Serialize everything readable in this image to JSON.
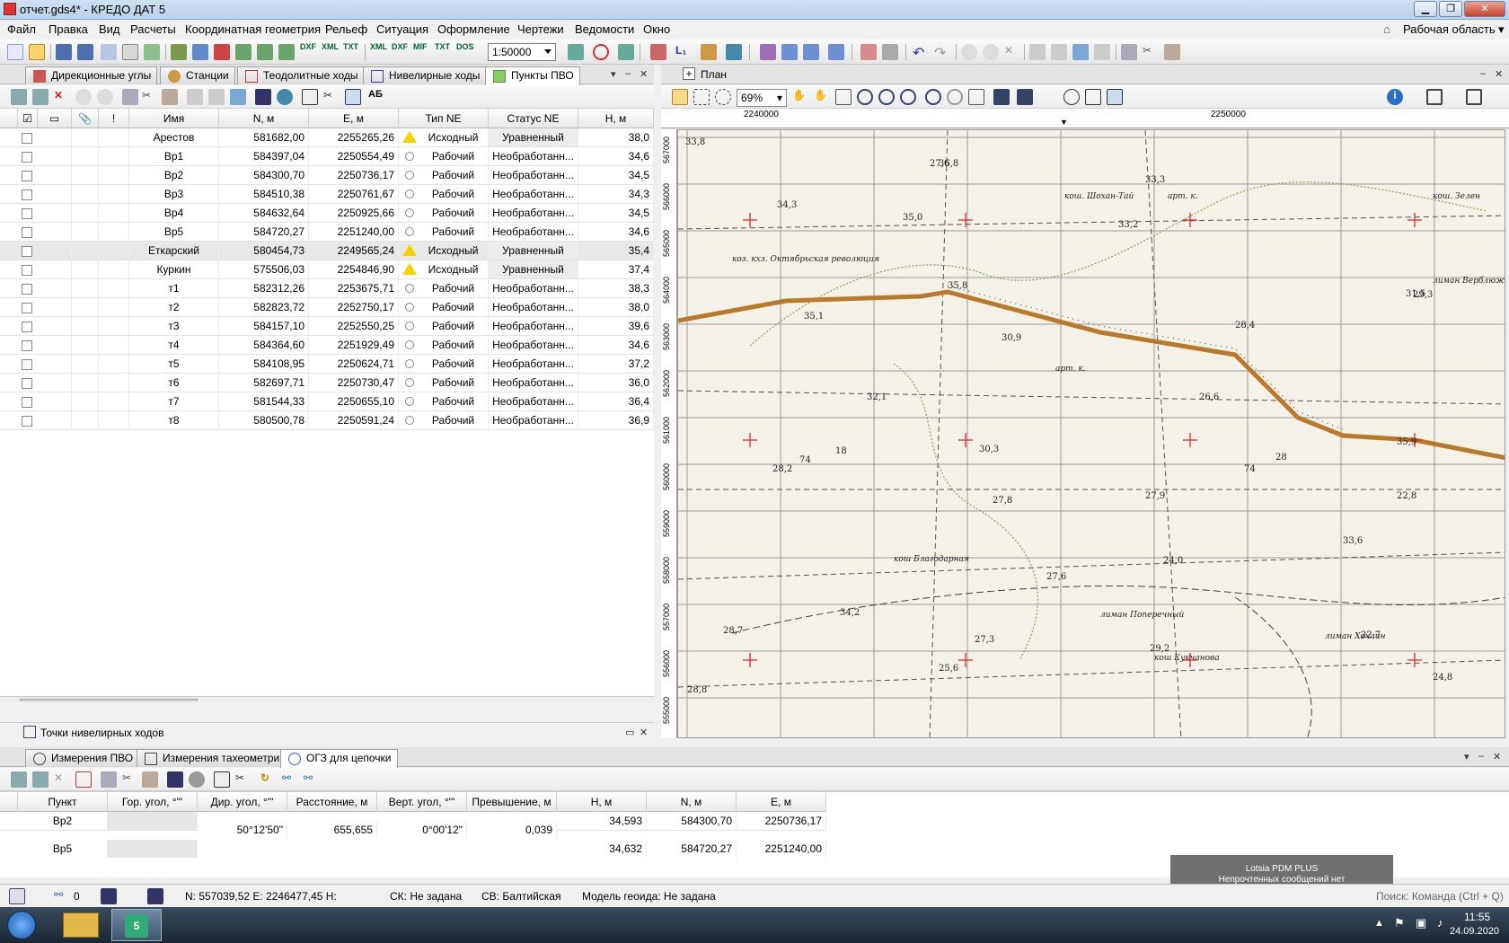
{
  "window": {
    "title": "отчет.gds4* - КРЕДО ДАТ 5"
  },
  "menu": [
    "Файл",
    "Правка",
    "Вид",
    "Расчеты",
    "Координатная геометрия",
    "Рельеф",
    "Ситуация",
    "Оформление",
    "Чертежи",
    "Ведомости",
    "Окно"
  ],
  "workspace": "Рабочая область",
  "toolbar": {
    "scale": "1:50000",
    "labels": {
      "dxf": "DXF",
      "xml": "XML",
      "txt": "TXT",
      "xml2": "XML",
      "dxf2": "DXF",
      "mif": "MIF",
      "txt2": "TXT",
      "dos": "DOS"
    }
  },
  "left_tabs": [
    {
      "label": "Дирекционные углы"
    },
    {
      "label": "Станции"
    },
    {
      "label": "Теодолитные ходы"
    },
    {
      "label": "Нивелирные ходы"
    },
    {
      "label": "Пункты ПВО"
    }
  ],
  "plan": {
    "title": "План",
    "zoom": "69%",
    "ruler_x": [
      "2240000",
      "2250000"
    ],
    "ruler_y": [
      "567000",
      "566000",
      "565000",
      "564000",
      "563000",
      "562000",
      "561000",
      "560000",
      "559000",
      "558000",
      "557000",
      "556000",
      "555000"
    ]
  },
  "grid": {
    "columns": [
      "Имя",
      "N, м",
      "E, м",
      "Тип NE",
      "Статус NE",
      "H, м"
    ],
    "rows": [
      {
        "name": "Арестов",
        "n": "581682,00",
        "e": "2255265,26",
        "type": "Исходный",
        "status": "Уравненный",
        "h": "38,0",
        "icon": "warn"
      },
      {
        "name": "Вр1",
        "n": "584397,04",
        "e": "2250554,49",
        "type": "Рабочий",
        "status": "Необработанн...",
        "h": "34,6",
        "icon": "circ"
      },
      {
        "name": "Вр2",
        "n": "584300,70",
        "e": "2250736,17",
        "type": "Рабочий",
        "status": "Необработанн...",
        "h": "34,5",
        "icon": "circ"
      },
      {
        "name": "Вр3",
        "n": "584510,38",
        "e": "2250761,67",
        "type": "Рабочий",
        "status": "Необработанн...",
        "h": "34,3",
        "icon": "circ"
      },
      {
        "name": "Вр4",
        "n": "584632,64",
        "e": "2250925,66",
        "type": "Рабочий",
        "status": "Необработанн...",
        "h": "34,5",
        "icon": "circ"
      },
      {
        "name": "Вр5",
        "n": "584720,27",
        "e": "2251240,00",
        "type": "Рабочий",
        "status": "Необработанн...",
        "h": "34,6",
        "icon": "circ"
      },
      {
        "name": "Еткарский",
        "n": "580454,73",
        "e": "2249565,24",
        "type": "Исходный",
        "status": "Уравненный",
        "h": "35,4",
        "icon": "warn"
      },
      {
        "name": "Куркин",
        "n": "575506,03",
        "e": "2254846,90",
        "type": "Исходный",
        "status": "Уравненный",
        "h": "37,4",
        "icon": "warn"
      },
      {
        "name": "т1",
        "n": "582312,26",
        "e": "2253675,71",
        "type": "Рабочий",
        "status": "Необработанн...",
        "h": "38,3",
        "icon": "circ"
      },
      {
        "name": "т2",
        "n": "582823,72",
        "e": "2252750,17",
        "type": "Рабочий",
        "status": "Необработанн...",
        "h": "38,0",
        "icon": "circ"
      },
      {
        "name": "т3",
        "n": "584157,10",
        "e": "2252550,25",
        "type": "Рабочий",
        "status": "Необработанн...",
        "h": "39,6",
        "icon": "circ"
      },
      {
        "name": "т4",
        "n": "584364,60",
        "e": "2251929,49",
        "type": "Рабочий",
        "status": "Необработанн...",
        "h": "34,6",
        "icon": "circ"
      },
      {
        "name": "т5",
        "n": "584108,95",
        "e": "2250624,71",
        "type": "Рабочий",
        "status": "Необработанн...",
        "h": "37,2",
        "icon": "circ"
      },
      {
        "name": "т6",
        "n": "582697,71",
        "e": "2250730,47",
        "type": "Рабочий",
        "status": "Необработанн...",
        "h": "36,0",
        "icon": "circ"
      },
      {
        "name": "т7",
        "n": "581544,33",
        "e": "2250655,10",
        "type": "Рабочий",
        "status": "Необработанн...",
        "h": "36,4",
        "icon": "circ"
      },
      {
        "name": "т8",
        "n": "580500,78",
        "e": "2250591,24",
        "type": "Рабочий",
        "status": "Необработанн...",
        "h": "36,9",
        "icon": "circ"
      }
    ]
  },
  "collapsed_panel": "Точки нивелирных ходов",
  "bottom_tabs": [
    {
      "label": "Измерения ПВО"
    },
    {
      "label": "Измерения тахеометрии"
    },
    {
      "label": "ОГЗ для цепочки"
    }
  ],
  "bottom_grid": {
    "columns": [
      "Пункт",
      "Гор. угол, °'\"",
      "Дир. угол, °'\"",
      "Расстояние, м",
      "Верт. угол, °'\"",
      "Превышение, м",
      "H, м",
      "N, м",
      "E, м"
    ],
    "rows": [
      {
        "p": "Вр2",
        "h": "34,593",
        "n": "584300,70",
        "e": "2250736,17"
      },
      {
        "p": "Вр5",
        "h": "34,632",
        "n": "584720,27",
        "e": "2251240,00"
      }
    ],
    "between": {
      "dir": "50°12'50\"",
      "dist": "655,655",
      "vert": "0°00'12\"",
      "dh": "0,039"
    }
  },
  "map_labels": [
    "33,8",
    "36,8",
    "33,3",
    "34,3",
    "35,0",
    "33,2",
    "арт. к.",
    "кош. Шохан-Тай",
    "кош. Зелен",
    "коз. кхз. Октябрьская революция",
    "35,8",
    "28,4",
    "35,1",
    "30,9",
    "арт. к.",
    "26,6",
    "32,1",
    "18",
    "74",
    "30,3",
    "28",
    "74",
    "35,9",
    "28,2",
    "27,8",
    "27,9",
    "33,6",
    "кош Благодарная",
    "27,6",
    "24,0",
    "22,8",
    "28,7",
    "34,2",
    "27,3",
    "лиман Поперечный",
    "лиман Хохлин",
    "22,7",
    "29,2",
    "кош Кукчанова",
    "24,8",
    "25,6",
    "28,8",
    "лиман Верблюжья",
    "31,5",
    "29,3",
    "27,6"
  ],
  "status": {
    "count": "0",
    "coords": "N:  557039,52   E:  2246477,45   H:",
    "sk": "СК:  Не задана",
    "sv": "СВ:  Балтийская",
    "geoid": "Модель геоида:  Не задана"
  },
  "notify": {
    "line1": "Lotsia PDM PLUS",
    "line2": "Непрочтенных сообщений нет"
  },
  "command": "Поиск: Команда (Ctrl + Q)",
  "clock": {
    "time": "11:55",
    "date": "24.09.2020"
  },
  "colors": {
    "accent": "#3c7fc1",
    "road": "#b87a2a",
    "warn": "#f3d400",
    "grid_cross": "#d62020"
  }
}
